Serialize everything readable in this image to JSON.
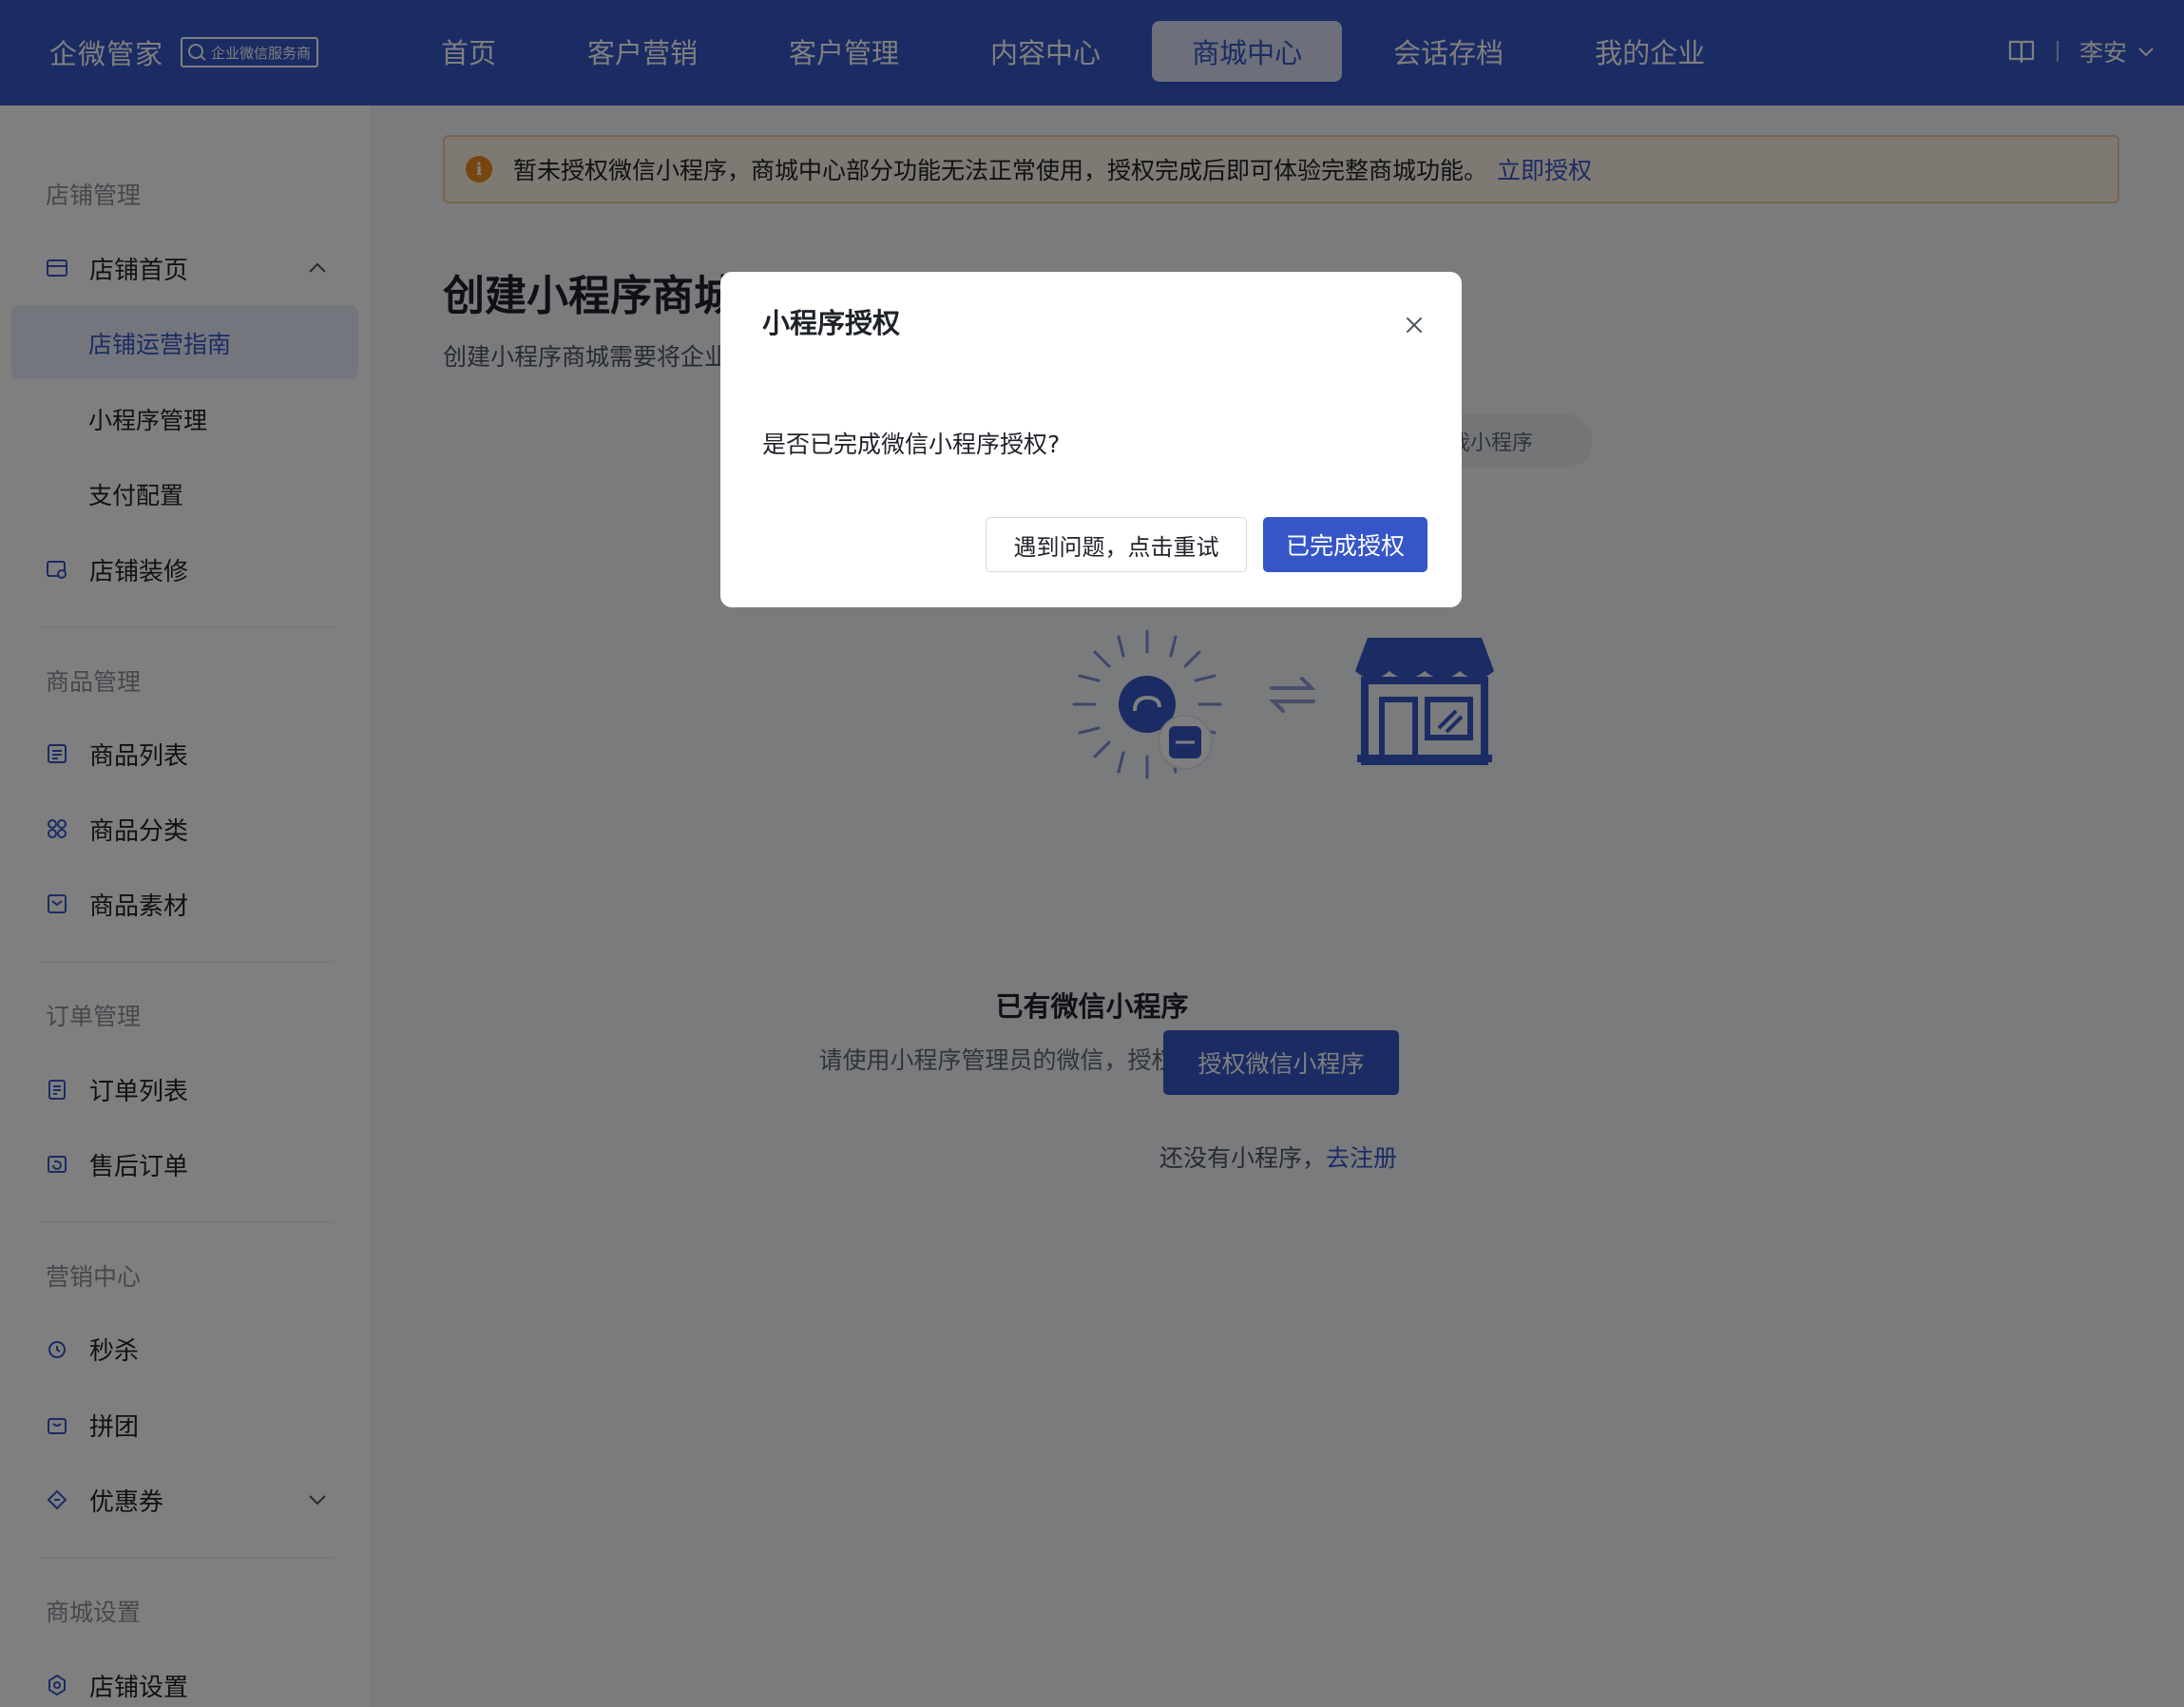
{
  "brand": {
    "name": "企微管家",
    "badge": "企业微信服务商"
  },
  "nav": {
    "items": [
      "首页",
      "客户营销",
      "客户管理",
      "内容中心",
      "商城中心",
      "会话存档",
      "我的企业"
    ],
    "active_index": 4
  },
  "topright": {
    "user": "李安",
    "icons": [
      "book-icon",
      "chevron-down-icon"
    ]
  },
  "sidebar": {
    "group_store": "店铺管理",
    "store_home": "店铺首页",
    "store_guide": "店铺运营指南",
    "miniapp_manage": "小程序管理",
    "payment_config": "支付配置",
    "store_decor": "店铺装修",
    "group_goods": "商品管理",
    "goods_list": "商品列表",
    "goods_category": "商品分类",
    "goods_material": "商品素材",
    "group_order": "订单管理",
    "order_list": "订单列表",
    "aftersale": "售后订单",
    "group_marketing": "营销中心",
    "seckill": "秒杀",
    "groupbuy": "拼团",
    "coupon": "优惠券",
    "group_settings": "商城设置",
    "store_settings": "店铺设置"
  },
  "alert": {
    "text": "暂未授权微信小程序，商城中心部分功能无法正常使用，授权完成后即可体验完整商城功能。",
    "link": "立即授权"
  },
  "main": {
    "title": "创建小程序商城",
    "desc": "创建小程序商城需要将企业",
    "pill": "我小程序",
    "section_title": "已有微信小程序",
    "section_desc": "请使用小程序管理员的微信，授权并创建小程序商城",
    "auth_button": "授权微信小程序",
    "register_prefix": "还没有小程序，",
    "register_link": "去注册"
  },
  "modal": {
    "title": "小程序授权",
    "body": "是否已完成微信小程序授权?",
    "retry_button": "遇到问题，点击重试",
    "done_button": "已完成授权"
  },
  "colors": {
    "primary": "#3656c8",
    "warning": "#f08a1d",
    "alert_bg": "#fdf2e6"
  }
}
